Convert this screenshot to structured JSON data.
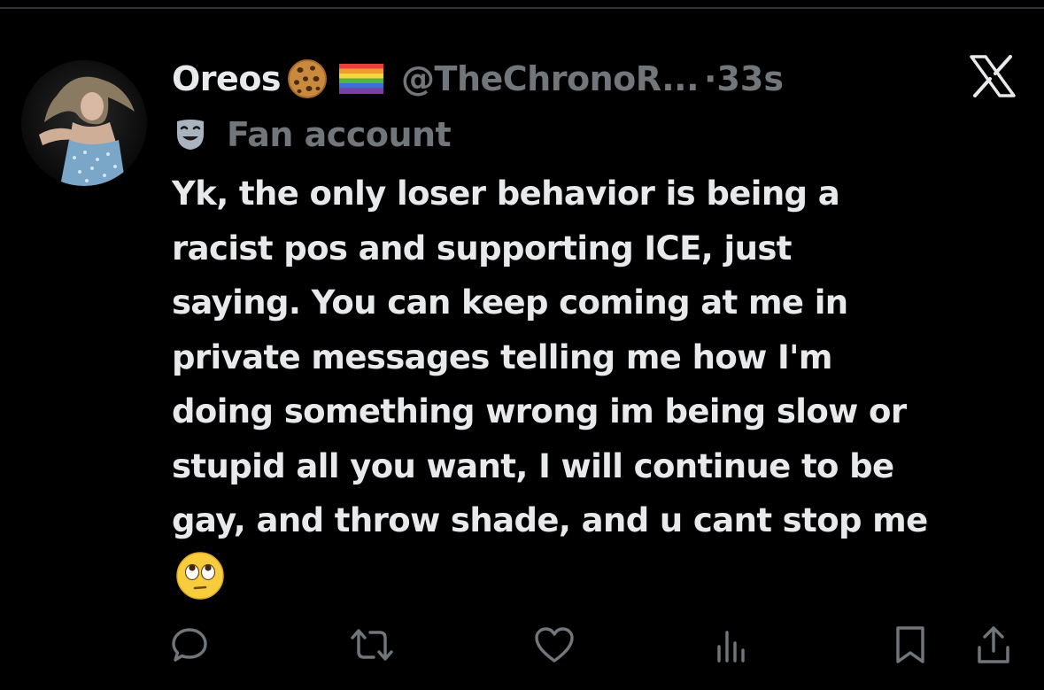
{
  "tweet": {
    "display_name": "Oreos",
    "name_emojis": [
      "cookie-emoji",
      "rainbow-flag-emoji"
    ],
    "handle": "@TheChronoR...",
    "separator": "·",
    "time": "33s",
    "label": "Fan account",
    "label_icon": "theater-masks-icon",
    "text": "Yk, the only loser behavior is being a\nracist pos and supporting ICE, just\nsaying. You can keep coming at me in\nprivate messages telling me how I'm\ndoing something wrong im being slow or\nstupid all you want, I will continue to be\ngay, and throw shade, and u cant stop me",
    "trailing_emoji": "face-with-rolling-eyes-emoji"
  },
  "actions": [
    "reply-icon",
    "repost-icon",
    "like-icon",
    "views-icon",
    "bookmark-icon",
    "share-icon"
  ],
  "colors": {
    "background": "#000000",
    "primary_text": "#e7e9ea",
    "secondary_text": "#71767b",
    "icon": "#71767b",
    "divider": "#2f3336"
  }
}
